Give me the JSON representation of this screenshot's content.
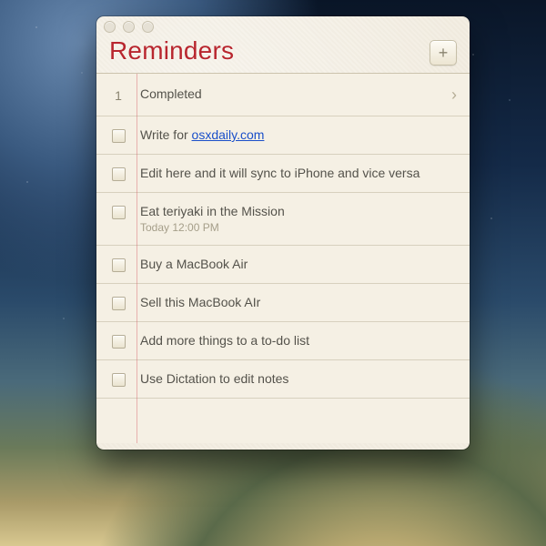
{
  "app": {
    "title": "Reminders",
    "add_label": "+"
  },
  "completed": {
    "count": "1",
    "label": "Completed"
  },
  "items": [
    {
      "prefix": "Write for ",
      "link": "osxdaily.com"
    },
    {
      "text": "Edit here and it will sync to iPhone and vice versa"
    },
    {
      "text": "Eat teriyaki in the Mission",
      "sub": "Today 12:00 PM"
    },
    {
      "text": "Buy a MacBook Air"
    },
    {
      "text": "Sell this MacBook AIr"
    },
    {
      "text": "Add more things to a to-do list"
    },
    {
      "text": "Use Dictation to edit notes"
    }
  ]
}
